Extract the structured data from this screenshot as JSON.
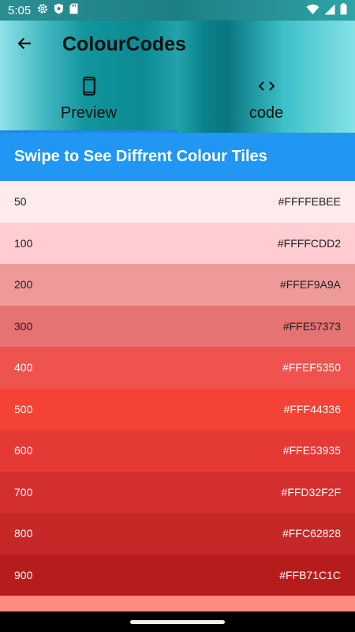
{
  "status_bar": {
    "time": "5:05",
    "icons": [
      "gear-icon",
      "shield-icon",
      "sd-card-icon",
      "wifi-icon",
      "signal-icon",
      "battery-icon"
    ]
  },
  "app_bar": {
    "title": "ColourCodes",
    "back_icon": "arrow-back-icon",
    "tabs": [
      {
        "label": "Preview",
        "icon": "phone-icon",
        "selected": true
      },
      {
        "label": "code",
        "icon": "code-icon",
        "selected": false
      }
    ]
  },
  "banner": {
    "text": "Swipe to See Diffrent Colour Tiles"
  },
  "colours": [
    {
      "shade": "50",
      "code": "#FFFFEBEE",
      "bg": "#FFEBEE",
      "fg": "#212121"
    },
    {
      "shade": "100",
      "code": "#FFFFCDD2",
      "bg": "#FFCDD2",
      "fg": "#212121"
    },
    {
      "shade": "200",
      "code": "#FFEF9A9A",
      "bg": "#EF9A9A",
      "fg": "#212121"
    },
    {
      "shade": "300",
      "code": "#FFE57373",
      "bg": "#E57373",
      "fg": "#212121"
    },
    {
      "shade": "400",
      "code": "#FFEF5350",
      "bg": "#EF5350",
      "fg": "#FFFFFF"
    },
    {
      "shade": "500",
      "code": "#FFF44336",
      "bg": "#F44336",
      "fg": "#FFFFFF"
    },
    {
      "shade": "600",
      "code": "#FFE53935",
      "bg": "#E53935",
      "fg": "#FFFFFF"
    },
    {
      "shade": "700",
      "code": "#FFD32F2F",
      "bg": "#D32F2F",
      "fg": "#FFFFFF"
    },
    {
      "shade": "800",
      "code": "#FFC62828",
      "bg": "#C62828",
      "fg": "#FFFFFF"
    },
    {
      "shade": "900",
      "code": "#FFB71C1C",
      "bg": "#B71C1C",
      "fg": "#FFFFFF"
    }
  ],
  "peek_colour": "#FF8A80",
  "accent": "#2196F3"
}
